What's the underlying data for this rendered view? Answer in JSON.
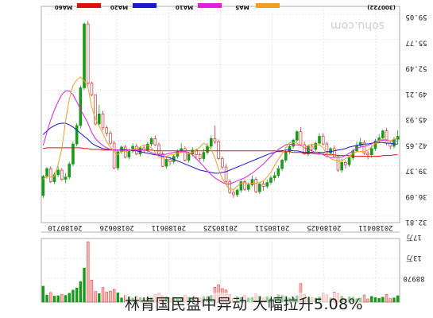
{
  "headline": "林肯国民盘中异动 大幅拉升5.08%",
  "chart_data": {
    "type": "candlestick",
    "mirrored": true,
    "watermark": "sohu.com",
    "code": "(300722)",
    "legend": [
      {
        "name": "MA5",
        "color": "#f0a020"
      },
      {
        "name": "MA10",
        "color": "#e020e0"
      },
      {
        "name": "MA20",
        "color": "#1a1acc"
      },
      {
        "name": "MA60",
        "color": "#e01010"
      }
    ],
    "price_ticks": [
      "59.05",
      "55.77",
      "52.49",
      "49.21",
      "45.93",
      "42.65",
      "39.37",
      "36.09",
      "32.81"
    ],
    "ylim": [
      32.81,
      59.05
    ],
    "date_labels": [
      "20180710",
      "20180626",
      "20180611",
      "20180525",
      "20180511",
      "20180425",
      "20180411"
    ],
    "volume_ticks": [
      "17万",
      "13万",
      "88970"
    ],
    "up_color": "#e03030",
    "down_color": "#1a9a1a",
    "candles": [
      [
        43.2,
        44.0,
        42.2,
        42.8
      ],
      [
        42.8,
        43.1,
        41.6,
        41.9
      ],
      [
        41.9,
        42.6,
        41.5,
        42.3
      ],
      [
        42.3,
        44.3,
        42.0,
        43.9
      ],
      [
        43.9,
        44.1,
        42.8,
        43.0
      ],
      [
        43.0,
        43.5,
        42.3,
        42.6
      ],
      [
        42.6,
        42.9,
        41.3,
        41.6
      ],
      [
        41.6,
        42.0,
        40.4,
        40.8
      ],
      [
        40.8,
        41.3,
        40.2,
        41.0
      ],
      [
        41.0,
        42.7,
        40.8,
        42.4
      ],
      [
        42.4,
        43.0,
        41.8,
        42.0
      ],
      [
        42.0,
        42.5,
        41.1,
        41.3
      ],
      [
        41.3,
        41.6,
        40.1,
        40.4
      ],
      [
        40.4,
        40.6,
        39.2,
        39.5
      ],
      [
        39.5,
        40.1,
        39.0,
        39.8
      ],
      [
        39.8,
        40.3,
        38.5,
        38.8
      ],
      [
        38.8,
        40.8,
        38.6,
        40.5
      ],
      [
        40.5,
        42.0,
        40.3,
        41.6
      ],
      [
        41.6,
        41.8,
        40.7,
        41.0
      ],
      [
        41.0,
        42.5,
        40.9,
        42.2
      ],
      [
        42.2,
        43.6,
        42.0,
        43.2
      ],
      [
        43.2,
        43.6,
        42.0,
        42.3
      ],
      [
        42.3,
        42.5,
        41.2,
        41.5
      ],
      [
        41.5,
        42.2,
        41.0,
        41.9
      ],
      [
        41.9,
        42.1,
        40.6,
        40.9
      ],
      [
        40.9,
        42.5,
        40.8,
        42.1
      ],
      [
        42.1,
        44.4,
        41.9,
        43.8
      ],
      [
        43.8,
        44.0,
        42.4,
        42.7
      ],
      [
        42.7,
        42.9,
        41.6,
        41.9
      ],
      [
        41.9,
        42.1,
        40.9,
        41.2
      ],
      [
        41.2,
        41.4,
        39.8,
        40.1
      ],
      [
        40.1,
        40.3,
        38.7,
        39.0
      ],
      [
        39.0,
        39.4,
        37.8,
        38.1
      ],
      [
        38.1,
        38.6,
        37.4,
        37.8
      ],
      [
        37.8,
        38.1,
        36.9,
        37.2
      ],
      [
        37.2,
        37.6,
        36.4,
        36.7
      ],
      [
        36.7,
        37.4,
        36.1,
        37.0
      ],
      [
        37.0,
        37.2,
        35.7,
        36.0
      ],
      [
        36.0,
        37.9,
        35.8,
        37.6
      ],
      [
        37.6,
        38.1,
        36.7,
        36.9
      ],
      [
        36.9,
        37.2,
        36.0,
        36.3
      ],
      [
        36.3,
        37.6,
        36.1,
        37.3
      ],
      [
        37.3,
        37.5,
        35.9,
        36.2
      ],
      [
        36.2,
        36.4,
        35.3,
        35.6
      ],
      [
        35.6,
        36.2,
        35.2,
        35.9
      ],
      [
        35.9,
        37.6,
        35.7,
        37.3
      ],
      [
        37.3,
        39.6,
        37.1,
        39.2
      ],
      [
        39.2,
        40.6,
        38.9,
        40.3
      ],
      [
        40.3,
        42.8,
        40.1,
        42.5
      ],
      [
        42.5,
        44.6,
        42.2,
        42.9
      ],
      [
        42.9,
        43.3,
        41.6,
        41.9
      ],
      [
        41.9,
        42.3,
        40.8,
        41.1
      ],
      [
        41.1,
        41.6,
        39.9,
        40.3
      ],
      [
        40.3,
        41.1,
        40.0,
        40.8
      ],
      [
        40.8,
        41.6,
        40.3,
        41.4
      ],
      [
        41.4,
        41.8,
        40.6,
        40.9
      ],
      [
        40.9,
        41.2,
        39.8,
        40.1
      ],
      [
        40.1,
        41.9,
        39.9,
        41.6
      ],
      [
        41.6,
        42.3,
        41.0,
        41.3
      ],
      [
        41.3,
        41.5,
        40.3,
        40.6
      ],
      [
        40.6,
        40.9,
        39.6,
        39.9
      ],
      [
        39.9,
        40.5,
        39.4,
        40.2
      ],
      [
        40.2,
        40.4,
        39.0,
        39.3
      ],
      [
        39.3,
        41.2,
        39.2,
        40.9
      ],
      [
        40.9,
        42.4,
        40.7,
        42.1
      ],
      [
        42.1,
        43.3,
        41.9,
        42.9
      ],
      [
        42.9,
        43.1,
        41.9,
        42.2
      ],
      [
        42.2,
        42.5,
        41.1,
        41.4
      ],
      [
        41.4,
        42.0,
        41.0,
        41.7
      ],
      [
        41.7,
        41.9,
        40.6,
        40.9
      ],
      [
        40.9,
        42.2,
        40.7,
        41.9
      ],
      [
        41.9,
        42.3,
        41.0,
        41.3
      ],
      [
        41.3,
        41.6,
        40.2,
        40.5
      ],
      [
        40.5,
        42.1,
        40.3,
        41.8
      ],
      [
        41.8,
        42.0,
        40.9,
        41.2
      ],
      [
        41.2,
        41.5,
        38.8,
        39.1
      ],
      [
        39.1,
        42.6,
        38.9,
        42.3
      ],
      [
        42.3,
        43.9,
        42.1,
        43.6
      ],
      [
        43.6,
        44.6,
        43.2,
        44.3
      ],
      [
        44.3,
        46.5,
        44.0,
        46.1
      ],
      [
        46.1,
        47.3,
        44.4,
        44.8
      ],
      [
        44.8,
        47.2,
        44.6,
        48.6
      ],
      [
        48.6,
        50.3,
        48.4,
        50.1
      ],
      [
        50.1,
        58.2,
        49.8,
        57.8
      ],
      [
        57.8,
        58.0,
        49.2,
        49.5
      ],
      [
        49.5,
        49.8,
        44.2,
        44.6
      ],
      [
        44.6,
        44.9,
        41.9,
        42.2
      ],
      [
        42.2,
        42.5,
        39.3,
        39.6
      ],
      [
        39.6,
        39.9,
        37.6,
        37.9
      ],
      [
        37.9,
        38.4,
        37.1,
        37.6
      ],
      [
        37.6,
        39.1,
        37.4,
        38.8
      ],
      [
        38.8,
        39.3,
        37.9,
        38.2
      ],
      [
        38.2,
        38.5,
        37.0,
        37.3
      ],
      [
        37.3,
        39.3,
        37.1,
        39.0
      ],
      [
        39.0,
        39.2,
        37.7,
        38.0
      ],
      [
        38.0,
        38.2,
        35.2,
        35.5
      ]
    ],
    "volume": [
      18,
      12,
      10,
      22,
      14,
      11,
      13,
      16,
      9,
      20,
      12,
      10,
      14,
      15,
      9,
      17,
      24,
      28,
      12,
      21,
      26,
      15,
      12,
      13,
      14,
      22,
      52,
      18,
      13,
      12,
      16,
      19,
      21,
      13,
      11,
      15,
      12,
      17,
      23,
      14,
      12,
      19,
      13,
      15,
      10,
      22,
      34,
      38,
      49,
      42,
      19,
      16,
      15,
      12,
      13,
      12,
      14,
      20,
      13,
      12,
      14,
      11,
      15,
      18,
      26,
      22,
      14,
      13,
      12,
      13,
      17,
      12,
      14,
      19,
      12,
      26,
      36,
      31,
      28,
      41,
      24,
      30,
      62,
      170,
      96,
      58,
      40,
      34,
      25,
      19,
      22,
      18,
      17,
      27,
      20,
      45
    ],
    "ma5": [
      43.0,
      42.8,
      42.6,
      42.8,
      42.8,
      42.7,
      42.3,
      41.8,
      41.4,
      41.2,
      41.2,
      41.2,
      41.0,
      40.6,
      40.3,
      40.0,
      40.0,
      40.1,
      40.3,
      40.8,
      41.7,
      42.1,
      42.1,
      42.2,
      42.0,
      41.7,
      42.0,
      42.3,
      42.4,
      42.4,
      41.7,
      40.9,
      40.2,
      39.4,
      38.5,
      37.9,
      37.4,
      37.2,
      37.1,
      37.1,
      37.0,
      37.2,
      37.1,
      36.7,
      36.3,
      36.3,
      36.9,
      37.7,
      38.9,
      40.4,
      41.5,
      42.0,
      42.3,
      41.8,
      41.4,
      41.1,
      40.9,
      41.1,
      41.1,
      41.0,
      40.8,
      40.8,
      40.6,
      40.4,
      40.5,
      41.1,
      41.7,
      42.0,
      42.1,
      41.8,
      41.6,
      41.5,
      41.3,
      41.2,
      41.3,
      40.8,
      41.2,
      41.8,
      42.5,
      43.6,
      44.5,
      45.5,
      47.0,
      49.6,
      50.4,
      50.9,
      50.5,
      49.8,
      48.0,
      45.2,
      41.6,
      39.5,
      38.0,
      37.9,
      38.0,
      37.6
    ],
    "ma10": [
      42.6,
      42.6,
      42.6,
      42.7,
      42.7,
      42.6,
      42.5,
      42.2,
      42.0,
      41.9,
      41.8,
      41.6,
      41.3,
      41.0,
      40.7,
      40.5,
      40.5,
      40.5,
      40.4,
      40.6,
      40.8,
      41.0,
      41.1,
      41.3,
      41.5,
      41.7,
      42.0,
      42.1,
      42.1,
      42.2,
      42.1,
      41.8,
      41.5,
      41.1,
      40.6,
      40.1,
      39.6,
      39.2,
      38.8,
      38.4,
      38.1,
      37.8,
      37.6,
      37.4,
      37.2,
      37.0,
      37.0,
      37.2,
      37.5,
      37.8,
      38.2,
      38.7,
      39.3,
      39.8,
      40.3,
      40.8,
      41.1,
      41.2,
      41.2,
      41.2,
      41.1,
      41.0,
      40.9,
      40.8,
      40.8,
      40.9,
      41.1,
      41.3,
      41.4,
      41.5,
      41.4,
      41.4,
      41.4,
      41.5,
      41.5,
      41.4,
      41.4,
      41.5,
      41.7,
      42.0,
      42.4,
      42.9,
      43.7,
      44.9,
      45.8,
      46.7,
      47.7,
      48.6,
      49.1,
      49.1,
      48.6,
      47.7,
      46.6,
      45.3,
      43.7,
      42.0
    ],
    "ma20": [
      42.2,
      42.2,
      42.3,
      42.3,
      42.4,
      42.4,
      42.4,
      42.3,
      42.2,
      42.2,
      42.1,
      42.0,
      41.9,
      41.8,
      41.6,
      41.5,
      41.4,
      41.3,
      41.2,
      41.2,
      41.1,
      41.1,
      41.1,
      41.1,
      41.1,
      41.1,
      41.2,
      41.3,
      41.3,
      41.4,
      41.4,
      41.3,
      41.3,
      41.1,
      41.0,
      40.8,
      40.6,
      40.4,
      40.2,
      40.0,
      39.8,
      39.6,
      39.4,
      39.2,
      39.0,
      38.8,
      38.6,
      38.5,
      38.4,
      38.4,
      38.5,
      38.6,
      38.7,
      38.8,
      39.0,
      39.2,
      39.4,
      39.6,
      39.8,
      40.0,
      40.2,
      40.4,
      40.5,
      40.6,
      40.7,
      40.8,
      40.9,
      41.0,
      41.1,
      41.2,
      41.3,
      41.3,
      41.4,
      41.4,
      41.4,
      41.4,
      41.4,
      41.5,
      41.5,
      41.6,
      41.8,
      42.0,
      42.3,
      42.8,
      43.2,
      43.6,
      44.0,
      44.4,
      44.7,
      44.9,
      44.9,
      44.8,
      44.6,
      44.3,
      43.9,
      43.4
    ],
    "ma60": [
      40.8,
      40.8,
      40.7,
      40.7,
      40.7,
      40.6,
      40.6,
      40.6,
      40.6,
      40.6,
      40.6,
      40.6,
      40.6,
      40.7,
      40.7,
      40.7,
      40.7,
      40.8,
      40.8,
      40.8,
      40.9,
      40.9,
      40.9,
      41.0,
      41.0,
      41.0,
      41.1,
      41.1,
      41.1,
      41.2,
      41.2,
      41.2,
      41.2,
      41.3,
      41.3,
      41.3,
      41.3,
      41.3,
      41.3,
      41.3,
      41.3,
      41.3,
      41.3,
      41.3,
      41.3,
      41.3,
      41.3,
      41.3,
      41.3,
      41.3,
      41.3,
      41.3,
      41.3,
      41.3,
      41.3,
      41.3,
      41.3,
      41.3,
      41.3,
      41.3,
      41.3,
      41.3,
      41.3,
      41.3,
      41.3,
      41.3,
      41.4,
      41.4,
      41.4,
      41.4,
      41.4,
      41.4,
      41.4,
      41.4,
      41.4,
      41.4,
      41.4,
      41.4,
      41.4,
      41.4,
      41.5,
      41.5,
      41.5,
      41.6,
      41.6,
      41.7,
      41.7,
      41.7,
      41.7,
      41.7,
      41.7,
      41.7,
      41.7,
      41.7,
      41.7,
      41.6
    ]
  }
}
